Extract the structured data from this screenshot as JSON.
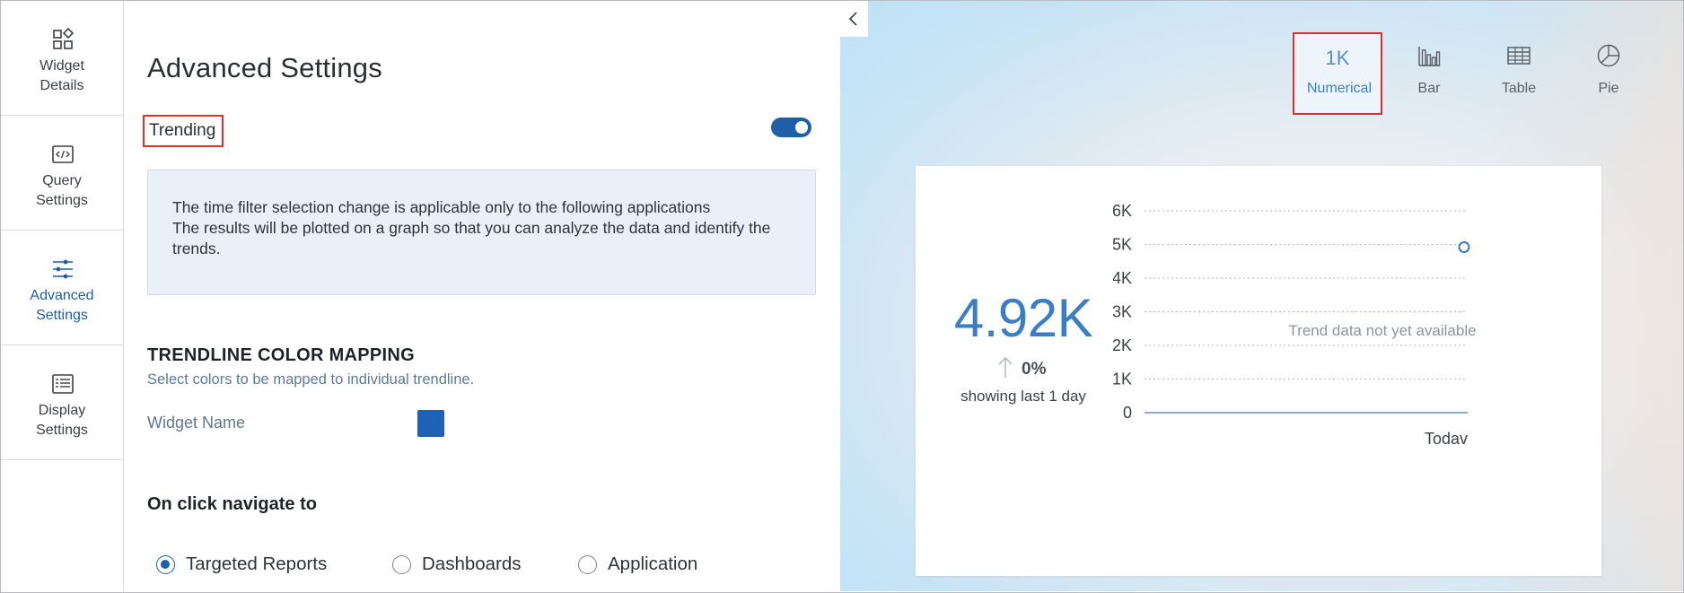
{
  "sidebar": {
    "items": [
      {
        "label": "Widget\nDetails",
        "icon": "widget-details-icon",
        "active": false
      },
      {
        "label": "Query\nSettings",
        "icon": "code-icon",
        "active": false
      },
      {
        "label": "Advanced\nSettings",
        "icon": "sliders-icon",
        "active": true
      },
      {
        "label": "Display\nSettings",
        "icon": "display-list-icon",
        "active": false
      }
    ]
  },
  "panel": {
    "title": "Advanced Settings",
    "trending_label": "Trending",
    "trending_enabled": true,
    "info_line1": "The time filter selection change is applicable only to the following applications",
    "info_line2": "The results will be plotted on a graph so that you can analyze the data and identify the trends.",
    "trendline_title": "TRENDLINE COLOR MAPPING",
    "trendline_subtitle": "Select colors to be mapped to individual trendline.",
    "widget_name_label": "Widget Name",
    "widget_color": "#1d62b8",
    "navigate_title": "On click navigate to",
    "navigate_options": [
      {
        "label": "Targeted Reports",
        "checked": true
      },
      {
        "label": "Dashboards",
        "checked": false
      },
      {
        "label": "Application",
        "checked": false
      }
    ]
  },
  "viz_tabs": [
    {
      "label": "Numerical",
      "glyph": "1K",
      "icon": "numerical-icon",
      "selected": true
    },
    {
      "label": "Bar",
      "icon": "bar-chart-icon",
      "selected": false
    },
    {
      "label": "Table",
      "icon": "table-icon",
      "selected": false
    },
    {
      "label": "Pie",
      "icon": "pie-chart-icon",
      "selected": false
    }
  ],
  "preview": {
    "metric_value": "4.92K",
    "trend_percent": "0%",
    "trend_direction": "up",
    "caption": "showing last 1 day",
    "empty_message": "Trend data not yet available"
  },
  "chart_data": {
    "type": "line",
    "y_ticks": [
      "6K",
      "5K",
      "4K",
      "3K",
      "2K",
      "1K",
      "0"
    ],
    "y_tick_values": [
      6000,
      5000,
      4000,
      3000,
      2000,
      1000,
      0
    ],
    "ylim": [
      0,
      6000
    ],
    "x_tick_labels": [
      "Todav"
    ],
    "grid": true,
    "series": [
      {
        "values": [
          4920
        ],
        "marker": "hollow-circle"
      }
    ],
    "accent_color": "#3b7ec6"
  }
}
